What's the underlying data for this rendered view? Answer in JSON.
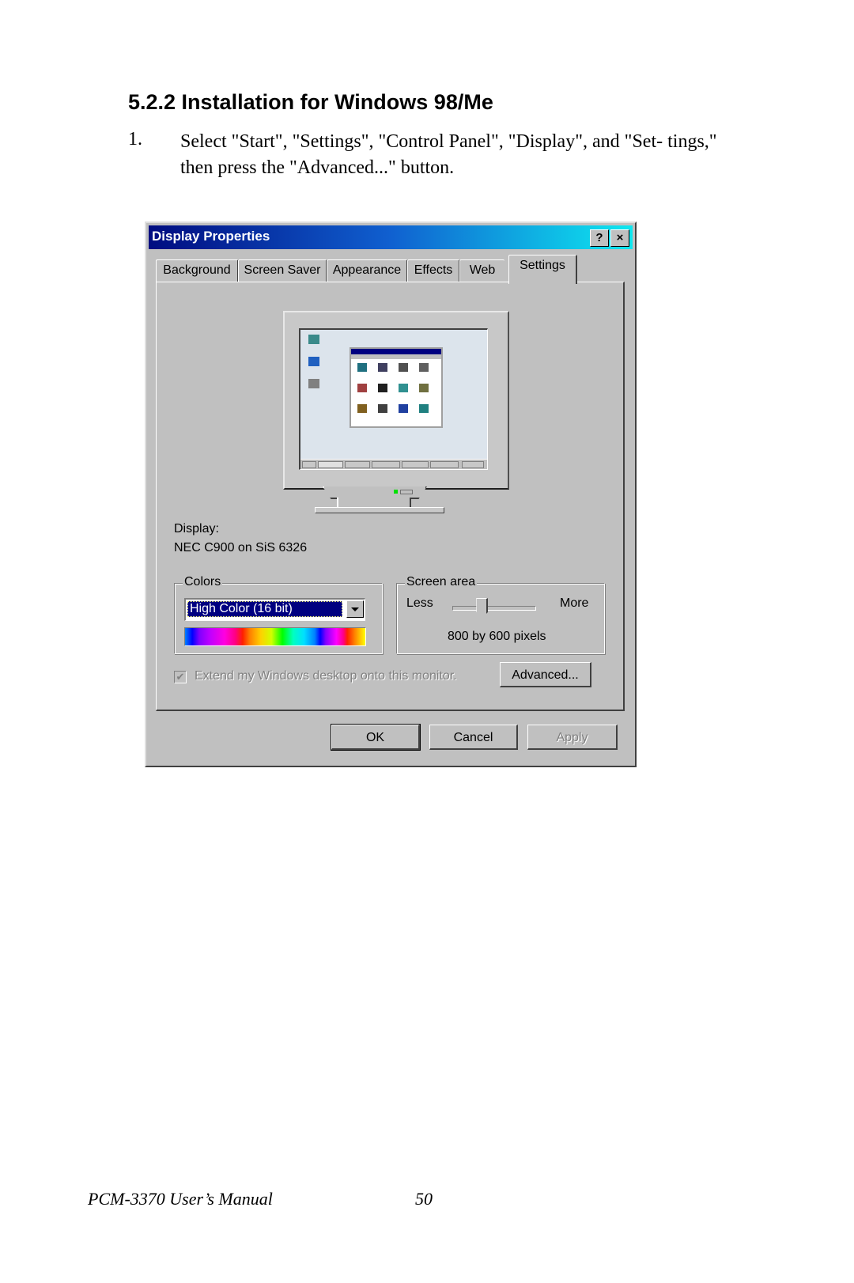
{
  "document": {
    "heading": "5.2.2 Installation for Windows 98/Me",
    "steps": [
      {
        "number": "1.",
        "text": "Select \"Start\", \"Settings\", \"Control Panel\", \"Display\", and \"Set- tings,\" then press the \"Advanced...\" button."
      }
    ],
    "footer": {
      "title": "PCM-3370 User’s Manual",
      "page": "50"
    }
  },
  "dialog": {
    "title": "Display Properties",
    "title_buttons": {
      "help": "?",
      "close": "×"
    },
    "tabs": [
      {
        "label": "Background",
        "active": false
      },
      {
        "label": "Screen Saver",
        "active": false
      },
      {
        "label": "Appearance",
        "active": false
      },
      {
        "label": "Effects",
        "active": false
      },
      {
        "label": "Web",
        "active": false
      },
      {
        "label": "Settings",
        "active": true
      }
    ],
    "display_label": "Display:",
    "display_value": "NEC C900 on SiS 6326",
    "colors": {
      "group_label": "Colors",
      "selected": "High Color (16 bit)"
    },
    "screen_area": {
      "group_label": "Screen area",
      "less_label": "Less",
      "more_label": "More",
      "value_text": "800 by 600 pixels",
      "slider_position_fraction": 0.35
    },
    "extend_checkbox": {
      "label": "Extend my Windows desktop onto this monitor.",
      "checked": true,
      "enabled": false
    },
    "buttons": {
      "advanced": "Advanced...",
      "ok": "OK",
      "cancel": "Cancel",
      "apply": "Apply"
    }
  }
}
